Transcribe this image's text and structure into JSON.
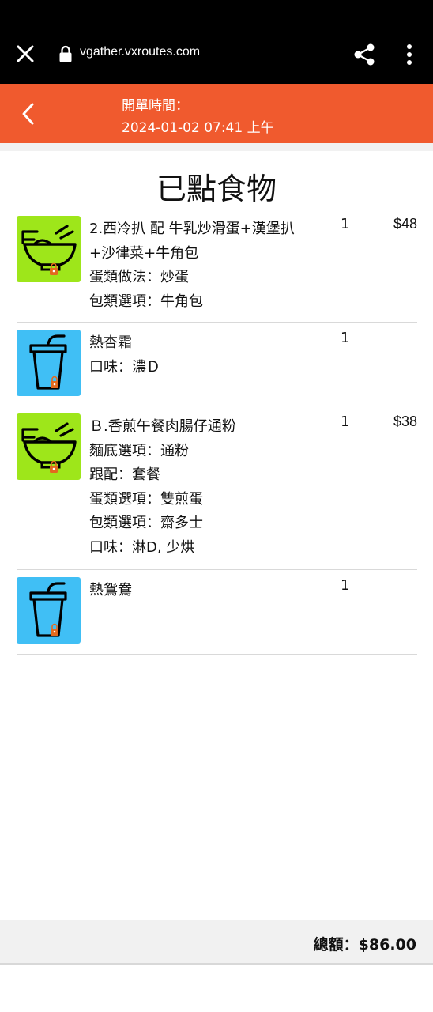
{
  "browser": {
    "url": "vgather.vxroutes.com",
    "close_icon": "close-icon",
    "lock_icon": "lock-icon",
    "share_icon": "share-icon",
    "menu_icon": "more-vert-icon"
  },
  "header": {
    "label": "開單時間：",
    "datetime": "2024-01-02 07:41 上午",
    "accent_color": "#f05a2e"
  },
  "page_title": "已點食物",
  "items": [
    {
      "icon": "noodle-bowl-icon",
      "icon_bg": "#9ee61a",
      "lines": [
        "2.西冷扒 配 牛乳炒滑蛋+漢堡扒+沙律菜+牛角包",
        "蛋類做法：炒蛋",
        "包類選項：牛角包"
      ],
      "qty": "1",
      "price": "$48"
    },
    {
      "icon": "drink-cup-icon",
      "icon_bg": "#40bff5",
      "lines": [
        "熱杏霜",
        "口味：濃Ｄ"
      ],
      "qty": "1",
      "price": ""
    },
    {
      "icon": "noodle-bowl-icon",
      "icon_bg": "#9ee61a",
      "lines": [
        "Ｂ.香煎午餐肉腸仔通粉",
        "麵底選項：通粉",
        "跟配：套餐",
        "蛋類選項：雙煎蛋",
        "包類選項：齋多士",
        "口味：淋D, 少烘"
      ],
      "qty": "1",
      "price": "$38"
    },
    {
      "icon": "drink-cup-icon",
      "icon_bg": "#40bff5",
      "lines": [
        "熱鴛鴦"
      ],
      "qty": "1",
      "price": ""
    }
  ],
  "footer": {
    "total": "總額：$86.00"
  }
}
